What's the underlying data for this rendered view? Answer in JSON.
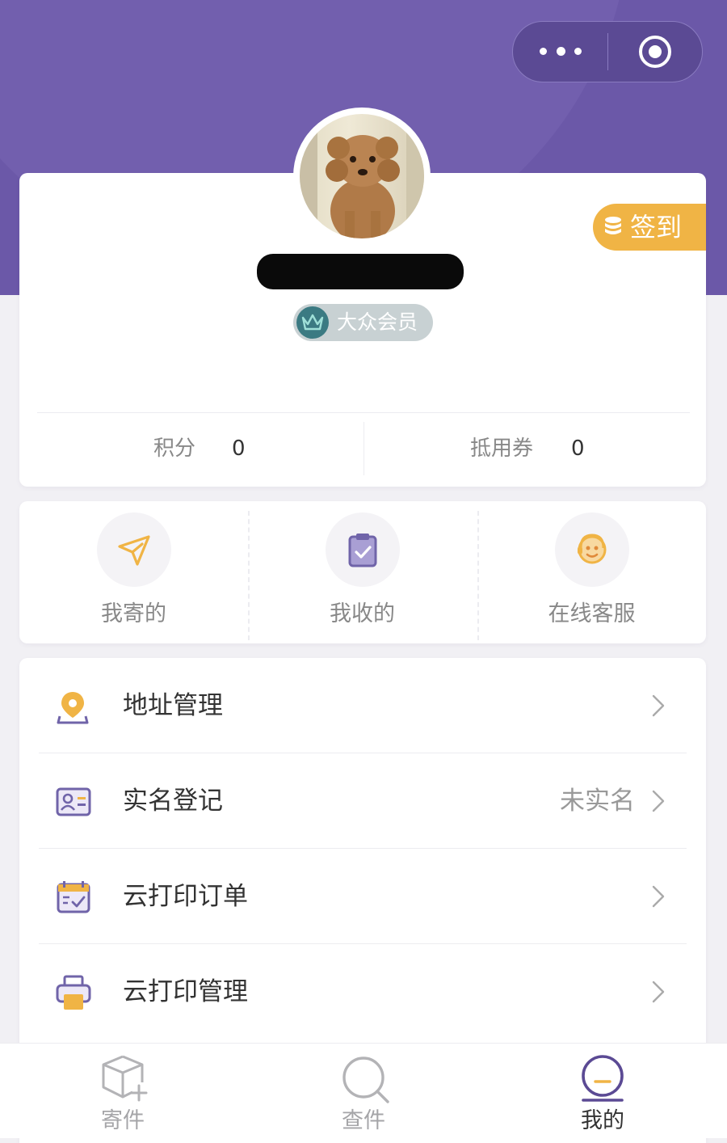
{
  "colors": {
    "header_purple": "#6b58a8",
    "accent_orange": "#f0b445",
    "icon_purple": "#7064a9",
    "member_teal": "#3b7a82"
  },
  "profile": {
    "avatar_icon": "poodle-photo",
    "checkin_label": "签到",
    "member_label": "大众会员",
    "points_label": "积分",
    "points_value": "0",
    "coupons_label": "抵用券",
    "coupons_value": "0"
  },
  "quick_actions": [
    {
      "label": "我寄的",
      "icon": "paper-plane-icon"
    },
    {
      "label": "我收的",
      "icon": "clipboard-check-icon"
    },
    {
      "label": "在线客服",
      "icon": "customer-service-icon"
    }
  ],
  "menu": [
    {
      "label": "地址管理",
      "value": "",
      "icon": "location-pin-icon"
    },
    {
      "label": "实名登记",
      "value": "未实名",
      "icon": "id-card-icon"
    },
    {
      "label": "云打印订单",
      "value": "",
      "icon": "print-order-icon"
    },
    {
      "label": "云打印管理",
      "value": "",
      "icon": "printer-icon"
    }
  ],
  "tabbar": [
    {
      "label": "寄件",
      "icon": "package-add-icon",
      "active": false
    },
    {
      "label": "查件",
      "icon": "search-icon",
      "active": false
    },
    {
      "label": "我的",
      "icon": "profile-icon",
      "active": true
    }
  ]
}
